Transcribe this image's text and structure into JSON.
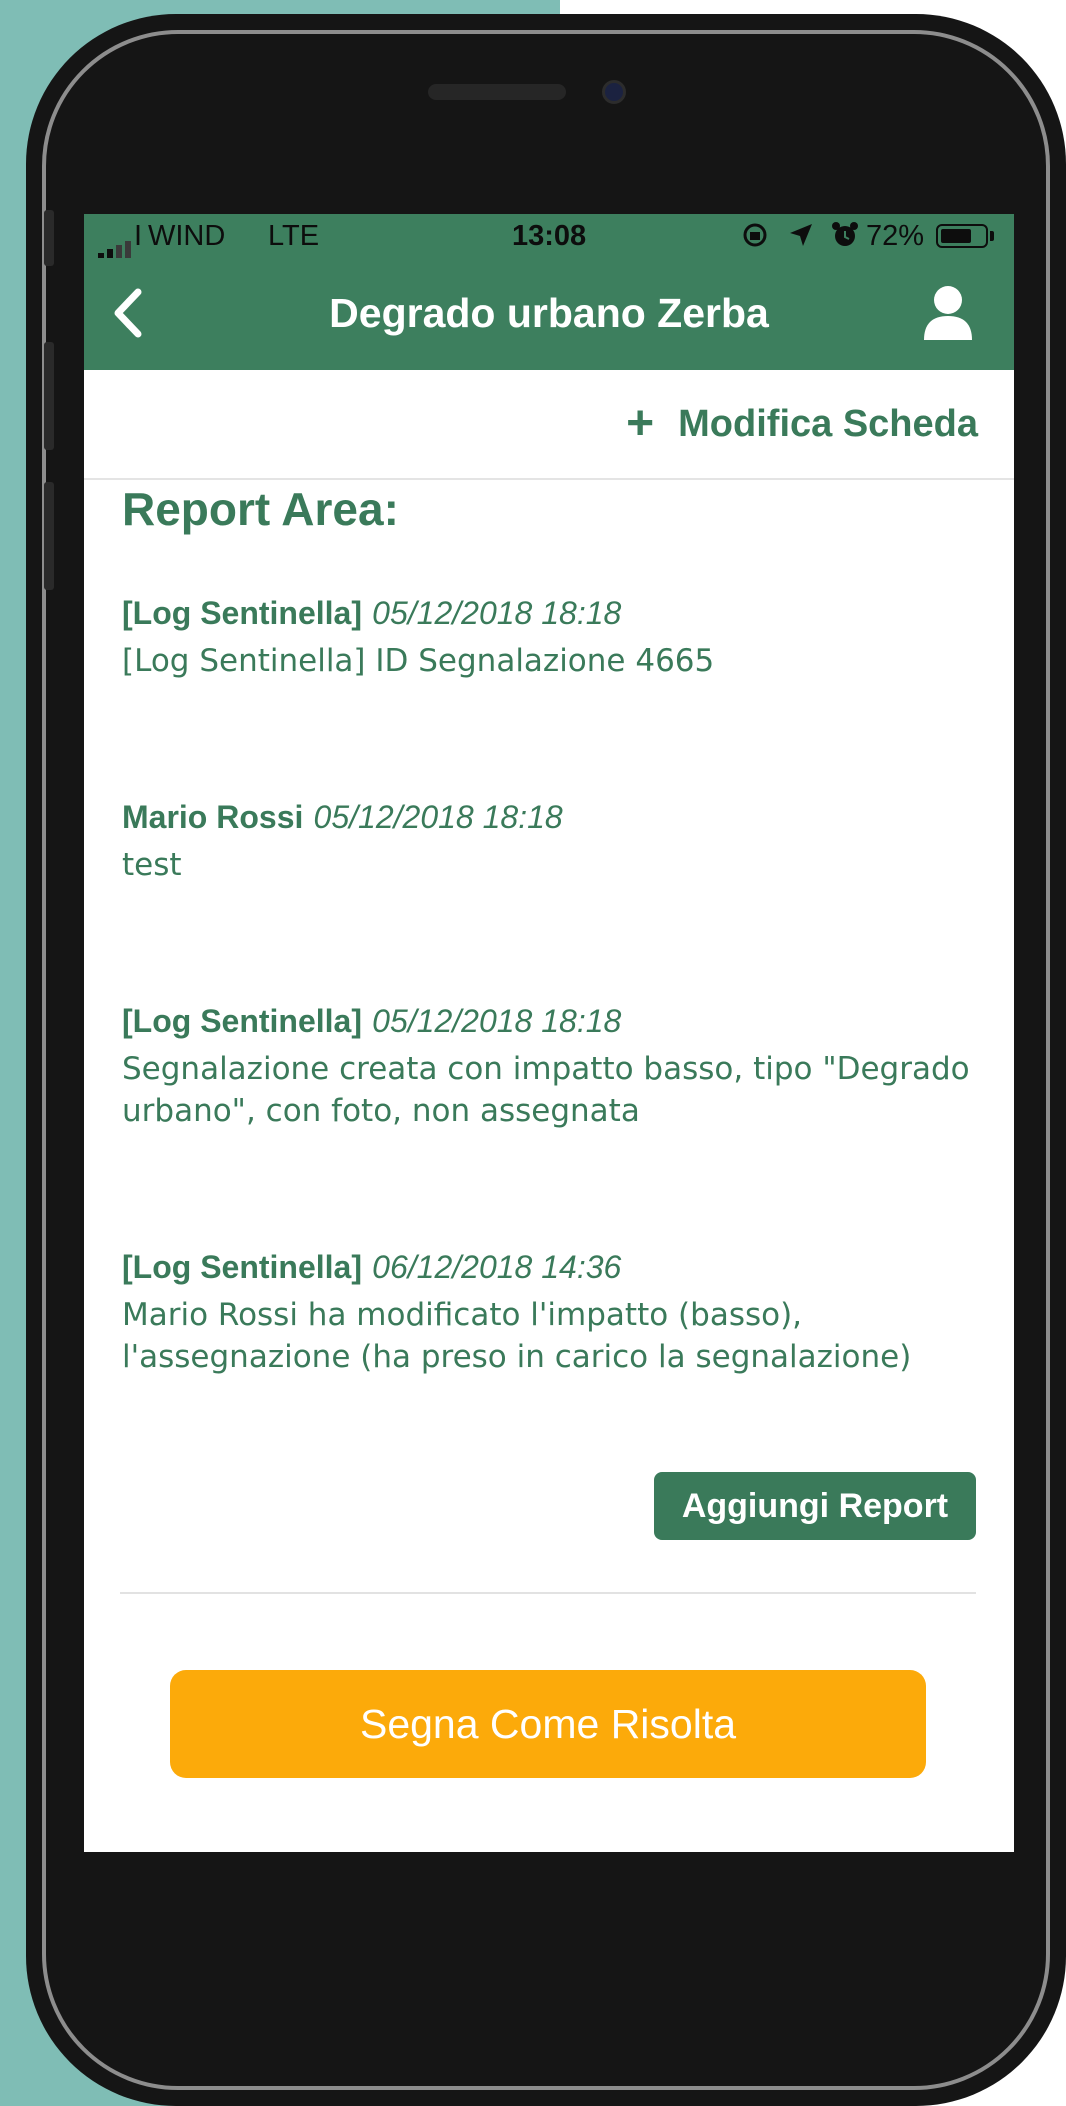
{
  "status_bar": {
    "carrier": "WIND",
    "network": "LTE",
    "time": "13:08",
    "icons": [
      "orientation-lock-icon",
      "location-arrow-icon",
      "alarm-icon"
    ],
    "battery_percent": "72%",
    "battery_level": 0.72
  },
  "nav": {
    "title": "Degrado urbano Zerba",
    "back_icon": "chevron-left-icon",
    "user_icon": "user-icon"
  },
  "toolbar": {
    "plus": "+",
    "edit_label": "Modifica Scheda"
  },
  "section_title": "Report Area:",
  "reports": [
    {
      "author": "[Log Sentinella]",
      "date": "05/12/2018 18:18",
      "text": "[Log Sentinella] ID Segnalazione 4665"
    },
    {
      "author": "Mario Rossi",
      "date": "05/12/2018 18:18",
      "text": "test"
    },
    {
      "author": "[Log Sentinella]",
      "date": "05/12/2018 18:18",
      "text": "Segnalazione creata con impatto basso, tipo \"Degrado urbano\", con foto, non assegnata"
    },
    {
      "author": "[Log Sentinella]",
      "date": "06/12/2018 14:36",
      "text": "Mario Rossi ha modificato l'impatto (basso), l'assegnazione (ha preso in carico la segnalazione)"
    }
  ],
  "add_report_label": "Aggiungi Report",
  "resolve_label": "Segna Come Risolta",
  "colors": {
    "primary": "#3d7f5e",
    "accent": "#fcaa0a",
    "background_left": "#7fbdb5"
  }
}
